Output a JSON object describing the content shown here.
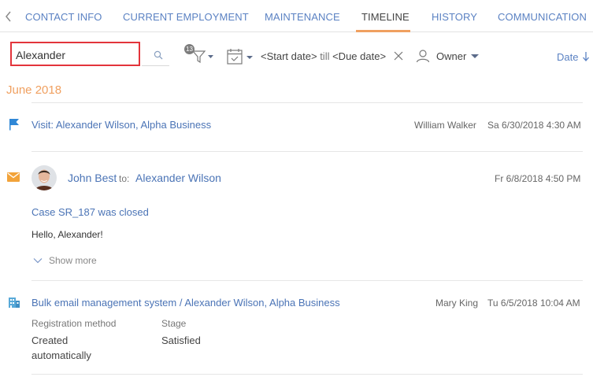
{
  "tabs": [
    {
      "label": "CONTACT INFO",
      "active": false
    },
    {
      "label": "CURRENT EMPLOYMENT",
      "active": false
    },
    {
      "label": "MAINTENANCE",
      "active": false
    },
    {
      "label": "TIMELINE",
      "active": true
    },
    {
      "label": "HISTORY",
      "active": false
    },
    {
      "label": "COMMUNICATION",
      "active": false
    }
  ],
  "filter": {
    "search_value": "Alexander",
    "filter_count": "13",
    "start_date": "<Start date>",
    "till": "till",
    "due_date": "<Due date>",
    "owner_label": "Owner",
    "sort_label": "Date"
  },
  "group": {
    "title": "June 2018"
  },
  "items": [
    {
      "type": "visit",
      "icon": "flag-icon",
      "title": "Visit: Alexander Wilson, Alpha Business",
      "owner": "William Walker",
      "datetime": "Sa 6/30/2018 4:30 AM"
    },
    {
      "type": "email",
      "icon": "mail-icon",
      "from": "John Best",
      "to_label": "to:",
      "to": "Alexander Wilson",
      "datetime": "Fr 6/8/2018 4:50 PM",
      "subject": "Case SR_187 was closed",
      "body": "Hello, Alexander!",
      "show_more": "Show more"
    },
    {
      "type": "bulk-email",
      "icon": "bulk-email-icon",
      "title": "Bulk email management system / Alexander Wilson, Alpha Business",
      "owner": "Mary King",
      "datetime": "Tu 6/5/2018 10:04 AM",
      "fields": [
        {
          "label": "Registration method",
          "value": "Created automatically"
        },
        {
          "label": "Stage",
          "value": "Satisfied"
        }
      ]
    }
  ],
  "colors": {
    "accent": "#f0a060",
    "link": "#4b74b6",
    "highlight_border": "#e3343b"
  }
}
